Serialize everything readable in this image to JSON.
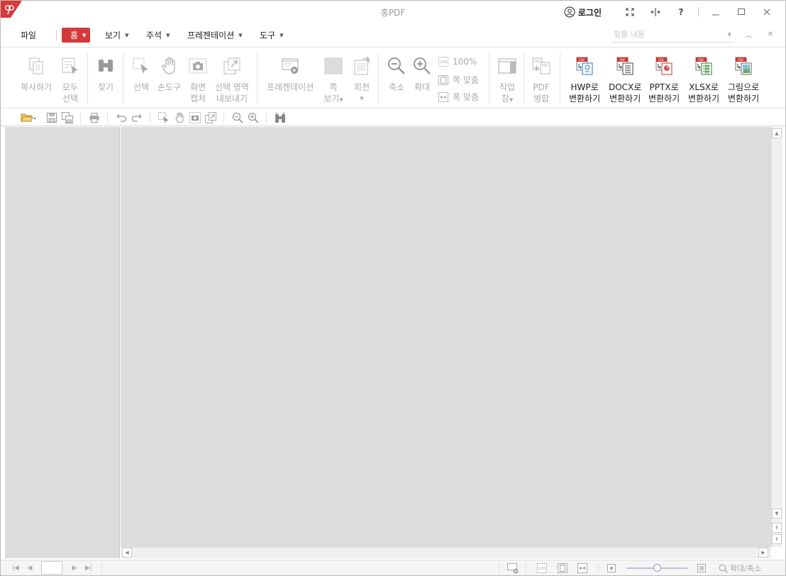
{
  "app": {
    "title": "홍PDF",
    "login_label": "로그인"
  },
  "menu": {
    "file": "파일",
    "home": "홈",
    "view": "보기",
    "annotate": "주석",
    "presentation": "프레젠테이션",
    "tools": "도구"
  },
  "search": {
    "placeholder": "찾을 내용"
  },
  "ribbon": {
    "copy": "복사하기",
    "select_all_1": "모두",
    "select_all_2": "선택",
    "find": "찾기",
    "select": "선택",
    "hand_tool": "손도구",
    "screen_capture_1": "화면",
    "screen_capture_2": "캡처",
    "export_area_1": "선택 영역",
    "export_area_2": "내보내기",
    "presentation": "프레젠테이션",
    "page_view_1": "쪽",
    "page_view_2": "보기",
    "rotate": "회전",
    "zoom_out": "축소",
    "zoom_in": "확대",
    "zoom_100": "100%",
    "fit_page": "쪽 맞춤",
    "fit_width": "폭 맞춤",
    "task_pane_1": "작업",
    "task_pane_2": "창",
    "pdf_merge_1": "PDF",
    "pdf_merge_2": "병합",
    "hwp_1": "HWP로",
    "hwp_2": "변환하기",
    "docx_1": "DOCX로",
    "docx_2": "변환하기",
    "pptx_1": "PPTX로",
    "pptx_2": "변환하기",
    "xlsx_1": "XLSX로",
    "xlsx_2": "변환하기",
    "image_1": "그림으로",
    "image_2": "변환하기"
  },
  "status": {
    "page_value": "",
    "zoom_label": "확대/축소"
  },
  "colors": {
    "accent": "#d43a3a",
    "workspace": "#dcdcdc"
  }
}
